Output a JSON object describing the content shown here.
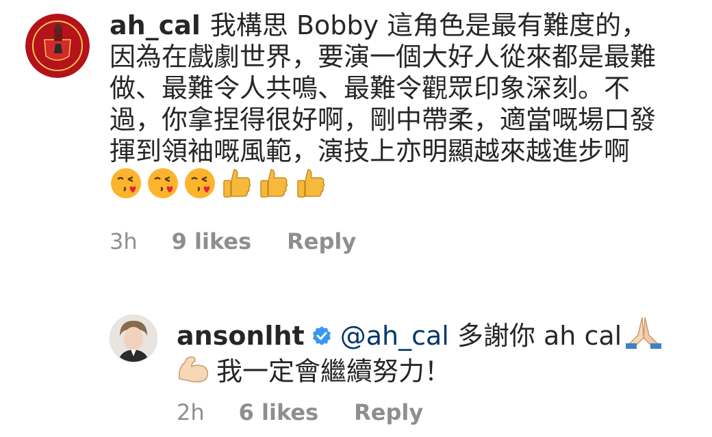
{
  "comments": [
    {
      "username": "ah_cal",
      "text": "我構思 Bobby 這角色是最有難度的，因為在戲劇世界，要演一個大好人從來都是最難做、最難令人共鳴、最難令觀眾印象深刻。不過，你拿捏得很好啊，剛中帶柔，適當嘅場口發揮到領袖嘅風範，演技上亦明顯越來越進步啊",
      "emojis": [
        "kissing-heart-face",
        "kissing-heart-face",
        "kissing-heart-face",
        "thumbs-up",
        "thumbs-up",
        "thumbs-up"
      ],
      "time": "3h",
      "likes": "9 likes",
      "reply": "Reply",
      "avatar_badge_top": "MANCHESTER",
      "avatar_badge_bottom": "UNITED"
    },
    {
      "username": "ansonlht",
      "verified": true,
      "mention": "@ah_cal",
      "text_a": "多謝你 ah cal",
      "text_b": "我一定會繼續努力！",
      "emojis": [
        "folded-hands",
        "flexed-biceps"
      ],
      "time": "2h",
      "likes": "6 likes",
      "reply": "Reply"
    }
  ],
  "colors": {
    "text": "#262626",
    "meta": "#8e8e8e",
    "mention": "#00376b",
    "verified": "#3897f0",
    "emoji_face": "#fdb42d",
    "thumb": "#f6b93b",
    "heart": "#e5213b"
  }
}
